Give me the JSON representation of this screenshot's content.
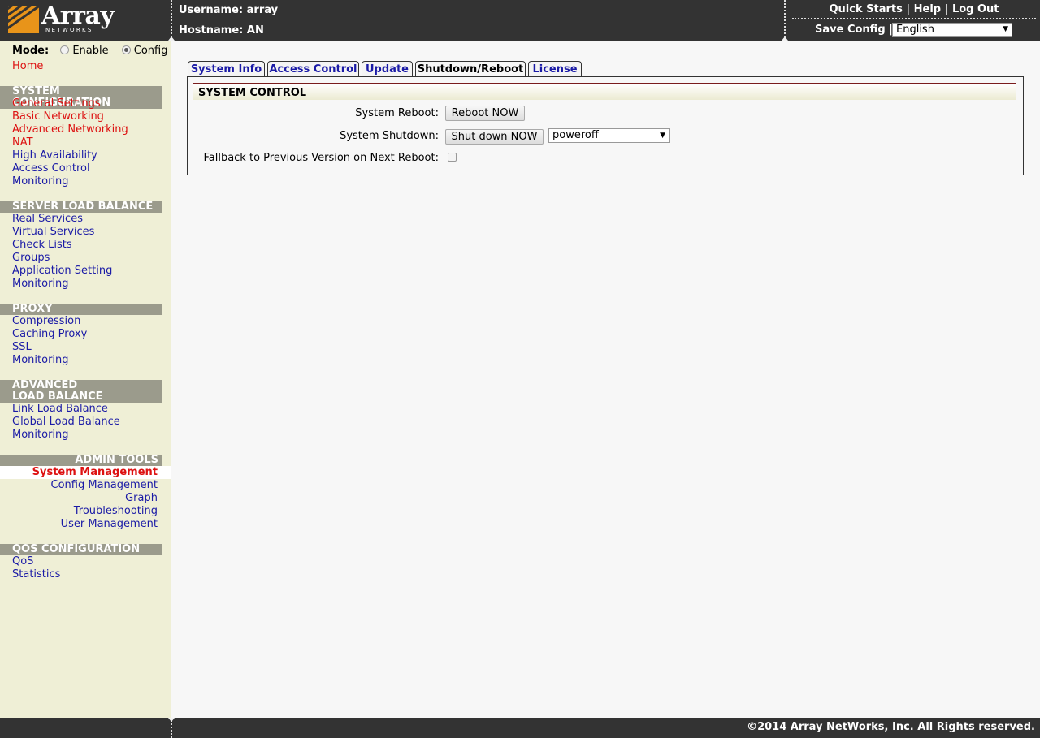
{
  "header": {
    "logo_text": "Array",
    "logo_sub": "NETWORKS",
    "username_label": "Username: array",
    "hostname_label": "Hostname: AN",
    "links": [
      "Quick Starts",
      "Help",
      "Log Out"
    ],
    "link_sep": "|",
    "save_config": "Save Config |",
    "language": "English"
  },
  "sidebar": {
    "mode_label": "Mode:",
    "mode_enable": "Enable",
    "mode_config": "Config",
    "home": "Home",
    "sections": [
      {
        "title": "SYSTEM CONFIGURATION",
        "items": [
          "General Settings",
          "Basic Networking",
          "Advanced Networking",
          "NAT",
          "High Availability",
          "Access Control",
          "Monitoring"
        ]
      },
      {
        "title": "SERVER LOAD BALANCE",
        "items": [
          "Real Services",
          "Virtual Services",
          "Check Lists",
          "Groups",
          "Application Setting",
          "Monitoring"
        ]
      },
      {
        "title": "PROXY",
        "items": [
          "Compression",
          "Caching Proxy",
          "SSL",
          "Monitoring"
        ]
      },
      {
        "title": "ADVANCED LOAD BALANCE",
        "items": [
          "Link Load Balance",
          "Global Load Balance",
          "Monitoring"
        ]
      },
      {
        "title": "ADMIN TOOLS",
        "items": [
          "System Management",
          "Config Management",
          "Graph",
          "Troubleshooting",
          "User Management"
        ]
      },
      {
        "title": "QOS CONFIGURATION",
        "items": [
          "QoS",
          "Statistics"
        ]
      }
    ]
  },
  "tabs": [
    "System Info",
    "Access Control",
    "Update",
    "Shutdown/Reboot",
    "License"
  ],
  "active_tab": "Shutdown/Reboot",
  "panel": {
    "title": "SYSTEM CONTROL",
    "reboot_label": "System Reboot:",
    "reboot_button": "Reboot NOW",
    "shutdown_label": "System Shutdown:",
    "shutdown_button": "Shut down NOW",
    "shutdown_mode": "poweroff",
    "fallback_label": "Fallback to Previous Version on Next Reboot:"
  },
  "footer": {
    "copyright": "©2014 Array NetWorks, Inc. All Rights reserved."
  },
  "colors": {
    "topbar": "#333333",
    "sidebar": "#efefd6",
    "section_header": "#9b9b8c",
    "link": "#1a1aa6",
    "active_link": "#dd1111",
    "logo_orange": "#e8941a"
  }
}
